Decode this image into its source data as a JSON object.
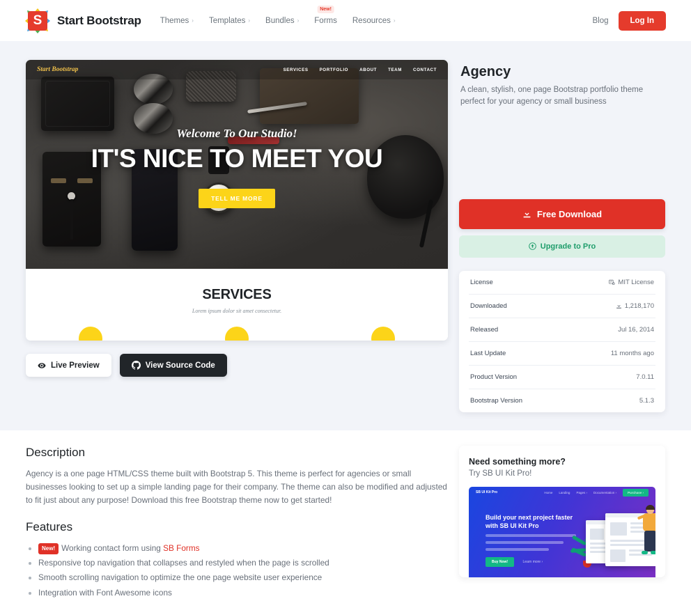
{
  "navbar": {
    "brand": "Start Bootstrap",
    "logo_letter": "S",
    "items": [
      {
        "label": "Themes",
        "caret": "›",
        "badge": ""
      },
      {
        "label": "Templates",
        "caret": "›",
        "badge": ""
      },
      {
        "label": "Bundles",
        "caret": "›",
        "badge": ""
      },
      {
        "label": "Forms",
        "caret": "",
        "badge": "New!"
      },
      {
        "label": "Resources",
        "caret": "›",
        "badge": ""
      }
    ],
    "blog": "Blog",
    "login": "Log In"
  },
  "preview": {
    "site_brand": "Start Bootstrap",
    "nav": [
      "SERVICES",
      "PORTFOLIO",
      "ABOUT",
      "TEAM",
      "CONTACT"
    ],
    "hero_sub": "Welcome To Our Studio!",
    "hero_title": "IT'S NICE TO MEET YOU",
    "hero_button": "TELL ME MORE",
    "services_title": "SERVICES",
    "services_sub": "Lorem ipsum dolor sit amet consectetur."
  },
  "actions": {
    "live_preview": "Live Preview",
    "view_source": "View Source Code"
  },
  "theme": {
    "name": "Agency",
    "description": "A clean, stylish, one page Bootstrap portfolio theme perfect for your agency or small business",
    "download_label": "Free Download",
    "upgrade_label": "Upgrade to Pro"
  },
  "details": [
    {
      "label": "License",
      "value": "MIT License",
      "icon": "certificate-icon"
    },
    {
      "label": "Downloaded",
      "value": "1,218,170",
      "icon": "download-icon"
    },
    {
      "label": "Released",
      "value": "Jul 16, 2014",
      "icon": ""
    },
    {
      "label": "Last Update",
      "value": "11 months ago",
      "icon": ""
    },
    {
      "label": "Product Version",
      "value": "7.0.11",
      "icon": ""
    },
    {
      "label": "Bootstrap Version",
      "value": "5.1.3",
      "icon": ""
    }
  ],
  "description": {
    "heading": "Description",
    "body": "Agency is a one page HTML/CSS theme built with Bootstrap 5. This theme is perfect for agencies or small businesses looking to set up a simple landing page for their company. The theme can also be modified and adjusted to fit just about any purpose! Download this free Bootstrap theme now to get started!"
  },
  "features": {
    "heading": "Features",
    "items": [
      {
        "badge": "New!",
        "text": "Working contact form using ",
        "link": "SB Forms"
      },
      {
        "badge": "",
        "text": "Responsive top navigation that collapses and restyled when the page is scrolled",
        "link": ""
      },
      {
        "badge": "",
        "text": "Smooth scrolling navigation to optimize the one page website user experience",
        "link": ""
      },
      {
        "badge": "",
        "text": "Integration with Font Awesome icons",
        "link": ""
      }
    ]
  },
  "promo": {
    "title": "Need something more?",
    "subtitle": "Try SB UI Kit Pro!",
    "img_brand": "SB UI Kit Pro",
    "img_nav": [
      "Home",
      "Landing",
      "Pages ›",
      "Documentation ›"
    ],
    "img_cta_small": "Purchase ›",
    "img_heading": "Build your next project faster with SB UI Kit Pro",
    "img_button": "Buy Now!",
    "img_link": "Learn more ›"
  },
  "colors": {
    "brand_red": "#e03127",
    "accent_yellow": "#fcd419",
    "pro_green": "#1f9d6b",
    "page_bg": "#f2f4f9"
  }
}
